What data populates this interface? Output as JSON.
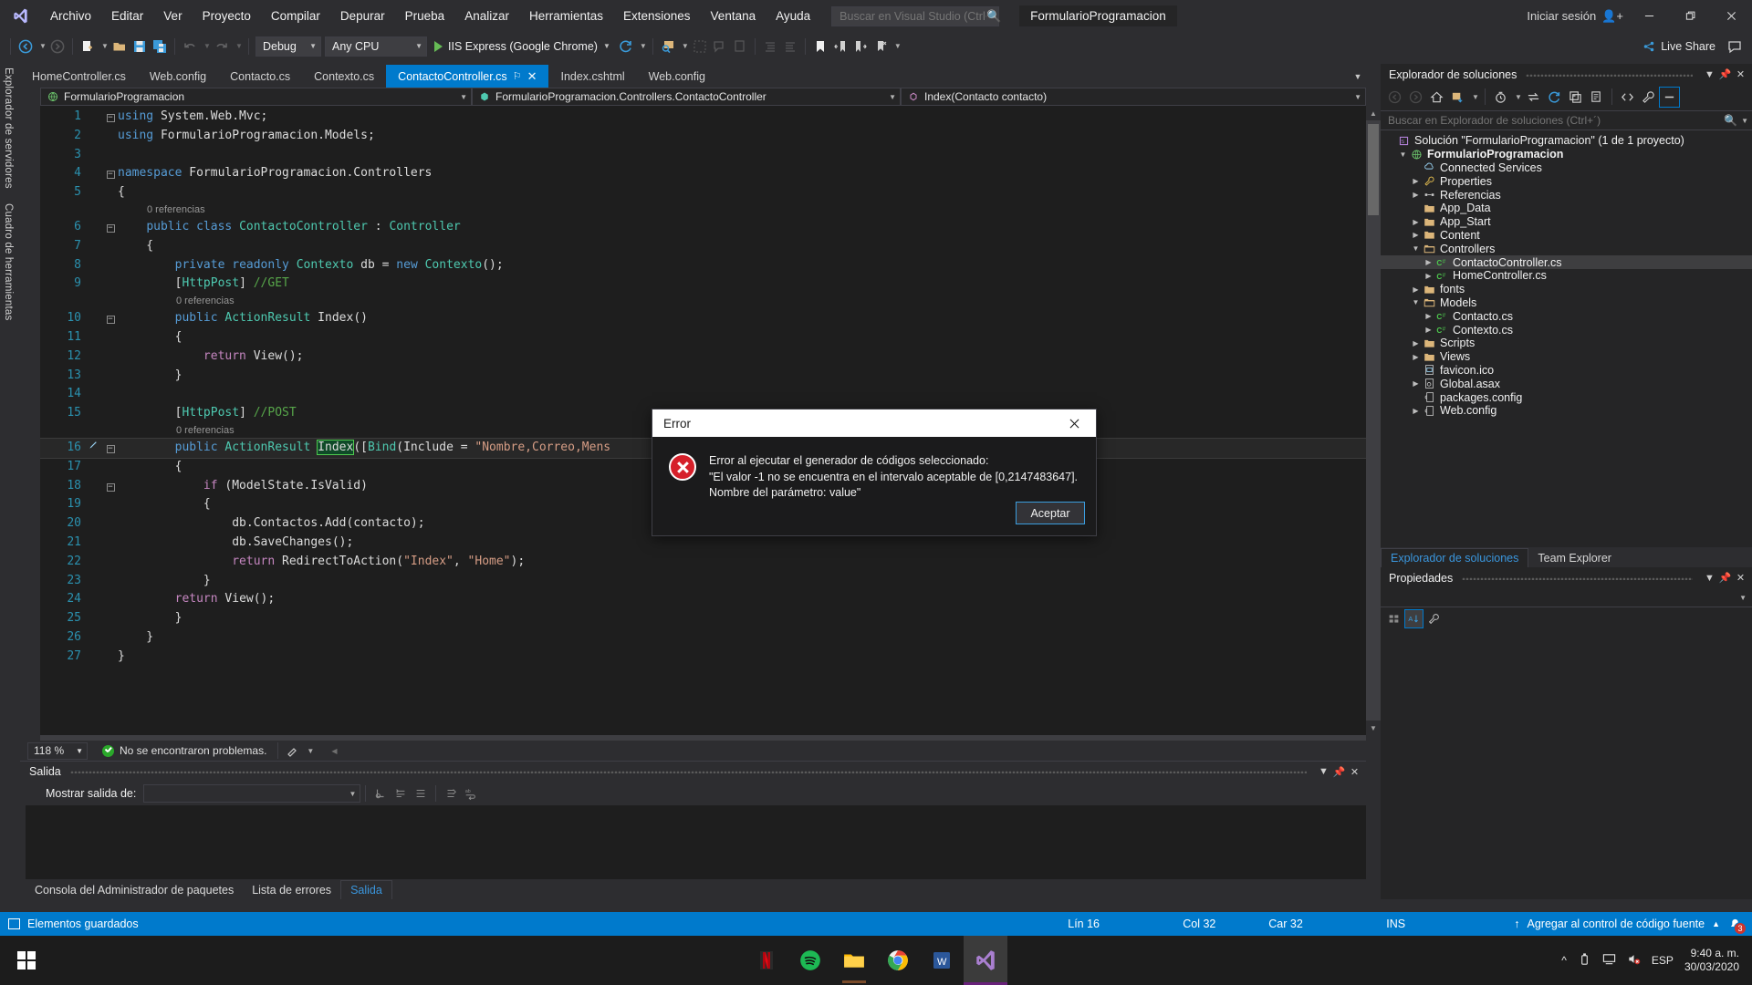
{
  "titlebar": {
    "logo": "visual-studio-logo",
    "menu": [
      "Archivo",
      "Editar",
      "Ver",
      "Proyecto",
      "Compilar",
      "Depurar",
      "Prueba",
      "Analizar",
      "Herramientas",
      "Extensiones",
      "Ventana",
      "Ayuda"
    ],
    "search_placeholder": "Buscar en Visual Studio (Ctrl+Q)",
    "document_title": "FormularioProgramacion",
    "signin_label": "Iniciar sesión",
    "window_buttons": [
      "minimize",
      "restore",
      "close"
    ]
  },
  "toolbar": {
    "config_combo": "Debug",
    "platform_combo": "Any CPU",
    "run_label": "IIS Express (Google Chrome)",
    "live_share": "Live Share"
  },
  "left_tabs": [
    "Explorador de servidores",
    "Cuadro de herramientas"
  ],
  "editor_tabs": [
    {
      "label": "HomeController.cs",
      "active": false
    },
    {
      "label": "Web.config",
      "active": false
    },
    {
      "label": "Contacto.cs",
      "active": false
    },
    {
      "label": "Contexto.cs",
      "active": false
    },
    {
      "label": "ContactoController.cs",
      "active": true
    },
    {
      "label": "Index.cshtml",
      "active": false
    },
    {
      "label": "Web.config",
      "active": false
    }
  ],
  "navbar": {
    "project": "FormularioProgramacion",
    "type": "FormularioProgramacion.Controllers.ContactoController",
    "member": "Index(Contacto contacto)"
  },
  "code_lines": [
    {
      "n": 1,
      "fold": "minus",
      "indent": 0,
      "text": "using System.Web.Mvc;"
    },
    {
      "n": 2,
      "fold": "",
      "indent": 0,
      "text": "using FormularioProgramacion.Models;"
    },
    {
      "n": 3,
      "fold": "",
      "indent": 0,
      "text": ""
    },
    {
      "n": 4,
      "fold": "minus",
      "indent": 0,
      "text": "namespace FormularioProgramacion.Controllers"
    },
    {
      "n": 5,
      "fold": "",
      "indent": 0,
      "text": "{"
    },
    {
      "n": 6,
      "fold": "minus",
      "indent": 1,
      "text": "public class ContactoController : Controller",
      "ref": "0 referencias"
    },
    {
      "n": 7,
      "fold": "",
      "indent": 1,
      "text": "{"
    },
    {
      "n": 8,
      "fold": "",
      "indent": 2,
      "text": "private readonly Contexto db = new Contexto();"
    },
    {
      "n": 9,
      "fold": "",
      "indent": 2,
      "text": "[HttpPost] //GET"
    },
    {
      "n": 10,
      "fold": "minus",
      "indent": 2,
      "text": "public ActionResult Index()",
      "ref": "0 referencias"
    },
    {
      "n": 11,
      "fold": "",
      "indent": 2,
      "text": "{"
    },
    {
      "n": 12,
      "fold": "",
      "indent": 3,
      "text": "return View();"
    },
    {
      "n": 13,
      "fold": "",
      "indent": 2,
      "text": "}"
    },
    {
      "n": 14,
      "fold": "",
      "indent": 0,
      "text": ""
    },
    {
      "n": 15,
      "fold": "",
      "indent": 2,
      "text": "[HttpPost] //POST"
    },
    {
      "n": 16,
      "fold": "minus",
      "indent": 2,
      "text": "public ActionResult Index([Bind(Include = \"Nombre,Correo,Mens",
      "ref": "0 referencias",
      "current": true
    },
    {
      "n": 17,
      "fold": "",
      "indent": 2,
      "text": "{"
    },
    {
      "n": 18,
      "fold": "minus",
      "indent": 3,
      "text": "if (ModelState.IsValid)"
    },
    {
      "n": 19,
      "fold": "",
      "indent": 3,
      "text": "{"
    },
    {
      "n": 20,
      "fold": "",
      "indent": 4,
      "text": "db.Contactos.Add(contacto);"
    },
    {
      "n": 21,
      "fold": "",
      "indent": 4,
      "text": "db.SaveChanges();"
    },
    {
      "n": 22,
      "fold": "",
      "indent": 4,
      "text": "return RedirectToAction(\"Index\", \"Home\");"
    },
    {
      "n": 23,
      "fold": "",
      "indent": 3,
      "text": "}"
    },
    {
      "n": 24,
      "fold": "",
      "indent": 2,
      "text": "return View();"
    },
    {
      "n": 25,
      "fold": "",
      "indent": 2,
      "text": "}"
    },
    {
      "n": 26,
      "fold": "",
      "indent": 1,
      "text": "}"
    },
    {
      "n": 27,
      "fold": "",
      "indent": 0,
      "text": "}"
    }
  ],
  "editor_status": {
    "zoom": "118 %",
    "problems": "No se encontraron problemas."
  },
  "output_panel": {
    "title": "Salida",
    "show_output_label": "Mostrar salida de:",
    "show_output_value": "",
    "tabs": [
      {
        "label": "Consola del Administrador de paquetes",
        "active": false
      },
      {
        "label": "Lista de errores",
        "active": false
      },
      {
        "label": "Salida",
        "active": true
      }
    ]
  },
  "solution_explorer": {
    "title": "Explorador de soluciones",
    "search_placeholder": "Buscar en Explorador de soluciones (Ctrl+´)",
    "tree": [
      {
        "label": "Solución \"FormularioProgramacion\" (1 de 1 proyecto)",
        "depth": 0,
        "arrow": "",
        "icon": "solution-icon",
        "bold": false,
        "selected": false
      },
      {
        "label": "FormularioProgramacion",
        "depth": 1,
        "arrow": "down",
        "icon": "web-project-icon",
        "bold": true,
        "selected": false
      },
      {
        "label": "Connected Services",
        "depth": 2,
        "arrow": "",
        "icon": "connected-services-icon",
        "bold": false,
        "selected": false
      },
      {
        "label": "Properties",
        "depth": 2,
        "arrow": "right",
        "icon": "wrench-icon",
        "bold": false,
        "selected": false
      },
      {
        "label": "Referencias",
        "depth": 2,
        "arrow": "right",
        "icon": "references-icon",
        "bold": false,
        "selected": false
      },
      {
        "label": "App_Data",
        "depth": 2,
        "arrow": "",
        "icon": "folder-icon",
        "bold": false,
        "selected": false
      },
      {
        "label": "App_Start",
        "depth": 2,
        "arrow": "right",
        "icon": "folder-icon",
        "bold": false,
        "selected": false
      },
      {
        "label": "Content",
        "depth": 2,
        "arrow": "right",
        "icon": "folder-icon",
        "bold": false,
        "selected": false
      },
      {
        "label": "Controllers",
        "depth": 2,
        "arrow": "down",
        "icon": "folder-open-icon",
        "bold": false,
        "selected": false
      },
      {
        "label": "ContactoController.cs",
        "depth": 3,
        "arrow": "right",
        "icon": "csharp-file-icon",
        "bold": false,
        "selected": true
      },
      {
        "label": "HomeController.cs",
        "depth": 3,
        "arrow": "right",
        "icon": "csharp-file-icon",
        "bold": false,
        "selected": false
      },
      {
        "label": "fonts",
        "depth": 2,
        "arrow": "right",
        "icon": "folder-icon",
        "bold": false,
        "selected": false
      },
      {
        "label": "Models",
        "depth": 2,
        "arrow": "down",
        "icon": "folder-open-icon",
        "bold": false,
        "selected": false
      },
      {
        "label": "Contacto.cs",
        "depth": 3,
        "arrow": "right",
        "icon": "csharp-file-icon",
        "bold": false,
        "selected": false
      },
      {
        "label": "Contexto.cs",
        "depth": 3,
        "arrow": "right",
        "icon": "csharp-file-icon",
        "bold": false,
        "selected": false
      },
      {
        "label": "Scripts",
        "depth": 2,
        "arrow": "right",
        "icon": "folder-icon",
        "bold": false,
        "selected": false
      },
      {
        "label": "Views",
        "depth": 2,
        "arrow": "right",
        "icon": "folder-icon",
        "bold": false,
        "selected": false
      },
      {
        "label": "favicon.ico",
        "depth": 2,
        "arrow": "",
        "icon": "image-file-icon",
        "bold": false,
        "selected": false
      },
      {
        "label": "Global.asax",
        "depth": 2,
        "arrow": "right",
        "icon": "asax-file-icon",
        "bold": false,
        "selected": false
      },
      {
        "label": "packages.config",
        "depth": 2,
        "arrow": "",
        "icon": "config-file-icon",
        "bold": false,
        "selected": false
      },
      {
        "label": "Web.config",
        "depth": 2,
        "arrow": "right",
        "icon": "config-file-icon",
        "bold": false,
        "selected": false
      }
    ],
    "bottom_tabs": [
      {
        "label": "Explorador de soluciones",
        "active": true
      },
      {
        "label": "Team Explorer",
        "active": false
      }
    ]
  },
  "properties_panel": {
    "title": "Propiedades"
  },
  "dialog": {
    "title": "Error",
    "icon": "error-icon",
    "message_lines": [
      "Error al ejecutar el generador de códigos seleccionado:",
      "\"El valor -1 no se encuentra en el intervalo aceptable de [0,2147483647].",
      "Nombre del parámetro: value\""
    ],
    "ok_label": "Aceptar"
  },
  "statusbar": {
    "saved_label": "Elementos guardados",
    "line": "Lín 16",
    "col": "Col 32",
    "char": "Car 32",
    "ins": "INS",
    "source_control": "Agregar al control de código fuente",
    "notification_count": "3",
    "accent": "#007acc"
  },
  "taskbar": {
    "apps": [
      "netflix-icon",
      "spotify-icon",
      "file-explorer-icon",
      "google-chrome-icon",
      "word-icon",
      "visual-studio-icon"
    ],
    "language": "ESP",
    "time": "9:40 a. m.",
    "date": "30/03/2020"
  }
}
